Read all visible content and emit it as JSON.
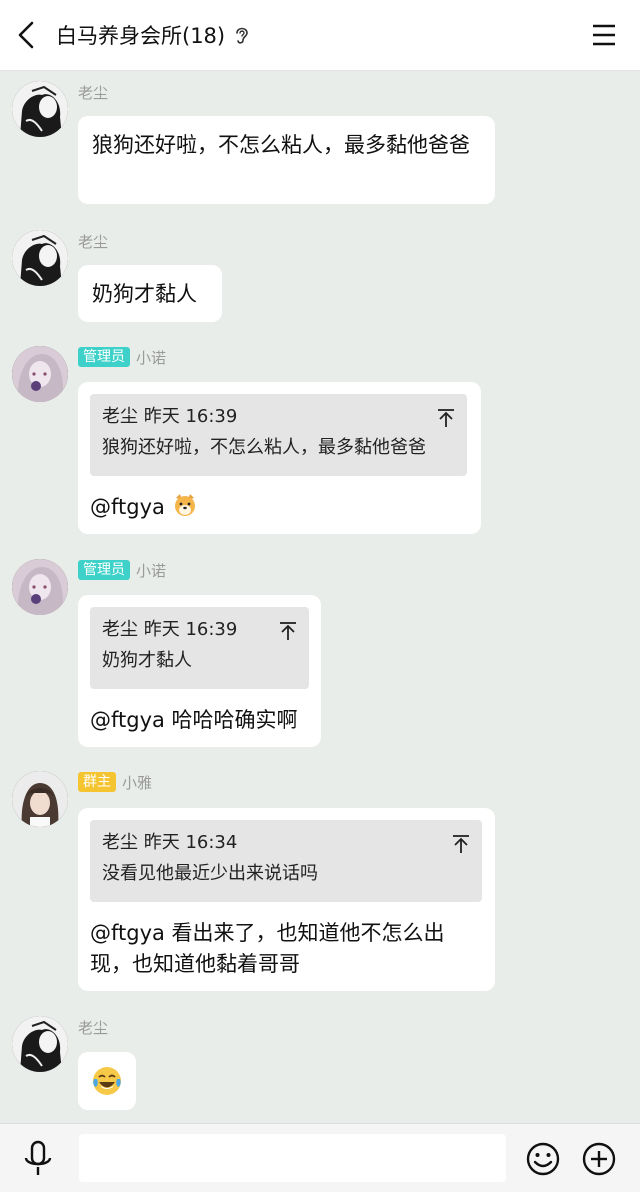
{
  "header": {
    "title": "白马养身会所(18)",
    "back_icon": "chevron-left-icon",
    "status_icon": "ear-icon",
    "menu_icon": "hamburger-menu-icon"
  },
  "colors": {
    "admin_badge": "#3dd1c9",
    "owner_badge": "#f5c431",
    "background": "#e9ede9"
  },
  "messages": [
    {
      "sender": "老尘",
      "text": "狼狗还好啦，不怎么粘人，最多黏他爸爸"
    },
    {
      "sender": "老尘",
      "text": "奶狗才黏人"
    },
    {
      "sender": "小诺",
      "badge": "管理员",
      "quote": {
        "header": "老尘 昨天 16:39",
        "text": "狼狗还好啦，不怎么粘人，最多黏他爸爸"
      },
      "reply": "@ftgya",
      "reply_emoji": "dog-face-emoji"
    },
    {
      "sender": "小诺",
      "badge": "管理员",
      "quote": {
        "header": "老尘 昨天 16:39",
        "text": "奶狗才黏人"
      },
      "reply": "@ftgya 哈哈哈确实啊"
    },
    {
      "sender": "小雅",
      "badge": "群主",
      "quote": {
        "header": "老尘 昨天 16:34",
        "text": "没看见他最近少出来说话吗"
      },
      "reply": "@ftgya 看出来了，也知道他不怎么出现，也知道他黏着哥哥"
    },
    {
      "sender": "老尘",
      "emoji": "tears-of-joy-emoji"
    }
  ],
  "input_bar": {
    "placeholder": "",
    "mic_icon": "microphone-icon",
    "emoji_icon": "smiley-icon",
    "plus_icon": "plus-circle-icon"
  }
}
